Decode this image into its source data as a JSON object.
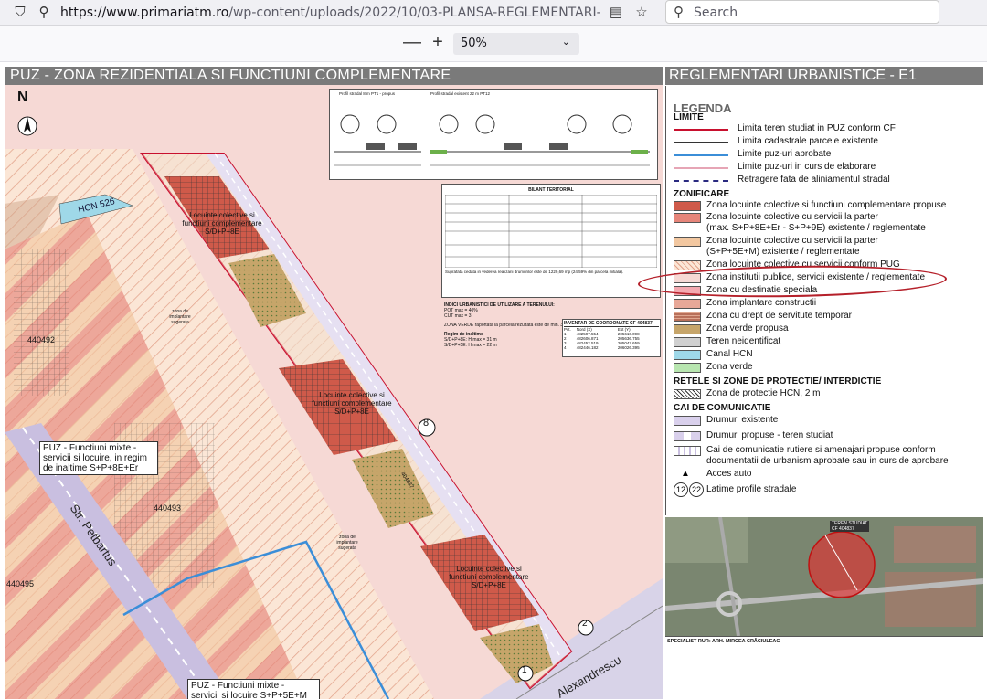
{
  "browser": {
    "url_main": "https://www.primariatm.ro",
    "url_rest": "/wp-content/uploads/2022/10/03-PLANSA-REGLEMENTARI-ETAPA-1_c",
    "search_placeholder": "Search"
  },
  "pdf_toolbar": {
    "zoom_out": "—",
    "zoom_in": "+",
    "zoom_value": "50%"
  },
  "plan": {
    "title": "PUZ - ZONA REZIDENTIALA SI FUNCTIUNI COMPLEMENTARE",
    "north": "N",
    "hcn_label": "HCN 526",
    "parcels": [
      "440492",
      "440493",
      "440495",
      "404837"
    ],
    "lot_labels": [
      "Locuinte colective si functiuni complementare S/D+P+8E",
      "Locuinte colective si functiuni complementare S/D+P+8E",
      "Locuinte colective si functiuni complementare S/D+P+8E"
    ],
    "zone_implantare": "zona de implantare sugerata",
    "puz_mixte_1": [
      "PUZ - Functiuni mixte -",
      "servicii si locuire, in regim",
      "de inaltime S+P+8E+Er"
    ],
    "puz_mixte_2": [
      "PUZ - Functiuni mixte -",
      "servicii si locuire S+P+5E+M"
    ],
    "street_1": "Str. Petbartus",
    "street_2": "Alexandrescu",
    "profile_numbers": [
      "8",
      "2",
      "1"
    ],
    "profile_title_1": "Profil stradal 8 m PT1 - propus",
    "profile_title_2": "Profil stradal existent 22 m PT12",
    "bilant_title": "BILANT TERITORIAL",
    "bilant_note": "Suprafata cedata in vederea realizarii drumurilor este de 1229,69 mp (24,59% din parcela initiala).",
    "indici_title": "INDICI URBANISTICI DE UTILIZARE A TERENULUI:",
    "indici": [
      "POT max = 40%",
      "CUT max = 3"
    ],
    "zona_verde_note": "ZONA VERDE raportata la parcela rezultata este de min. 30% (min.1131,18 mp).",
    "regim_title": "Regim de inaltime",
    "regim": [
      "S/D+P+8E:   H max = 31 m",
      "S/D+P+5E:   H max = 22 m"
    ],
    "inventar_title": "INVENTAR DE COORDONATE   CF 404837",
    "inventar_headers": [
      "Pct.",
      "Nord (X)",
      "Est (Y)"
    ],
    "inventar_rows": [
      [
        "1",
        "482597.554",
        "205610.098"
      ],
      [
        "2",
        "482606.871",
        "205636.755"
      ],
      [
        "3",
        "482452.519",
        "205047.659"
      ],
      [
        "4",
        "482446.182",
        "206026.395"
      ]
    ]
  },
  "legend": {
    "panel_title": "REGLEMENTARI URBANISTICE - E1",
    "title": "LEGENDA",
    "limite_title": "LIMITE",
    "limite": [
      "Limita teren studiat in PUZ conform CF",
      "Limita cadastrale parcele existente",
      "Limite puz-uri aprobate",
      "Limite puz-uri in curs de elaborare",
      "Retragere fata de aliniamentul stradal"
    ],
    "zonificare_title": "ZONIFICARE",
    "zonificare": [
      "Zona locuinte colective si functiuni complementare propuse",
      "Zona locuinte colective cu servicii la parter",
      "(max. S+P+8E+Er - S+P+9E) existente / reglementate",
      "Zona locuinte colective cu servicii la parter",
      "(S+P+5E+M) existente / reglementate",
      "Zona locuinte colective cu servicii conform PUG",
      "Zona institutii publice, servicii existente / reglementate",
      "Zona cu destinatie speciala",
      "Zona implantare constructii",
      "Zona cu drept de servitute temporar",
      "Zona verde propusa",
      "Teren neidentificat",
      "Canal HCN",
      "Zona verde"
    ],
    "retele_title": "RETELE SI ZONE DE PROTECTIE/ INTERDICTIE",
    "retele": [
      "Zona de protectie HCN, 2 m"
    ],
    "cai_title": "CAI DE COMUNICATIE",
    "cai": [
      "Drumuri existente",
      "Drumuri propuse - teren studiat",
      "Cai de comunicatie rutiere si amenajari propuse conform",
      "documentatii de urbanism aprobate sau in curs de aprobare",
      "Acces auto",
      "Latime profile stradale"
    ],
    "profile_nums": [
      "12",
      "22"
    ],
    "aerial_label_1": "TEREN STUDIAT",
    "aerial_label_2": "CF 404837",
    "signature": "SPECIALIST RUR: ARH. MIRCEA CRĂCIULEAC"
  },
  "colors": {
    "accent_red": "#c8102e",
    "ellipse": "#b5202a",
    "zone_pink": "#f6d9d5",
    "zone_tan": "#f2c7a0",
    "road_purple": "#c9bfe0",
    "canal_blue": "#9fd8e8"
  }
}
